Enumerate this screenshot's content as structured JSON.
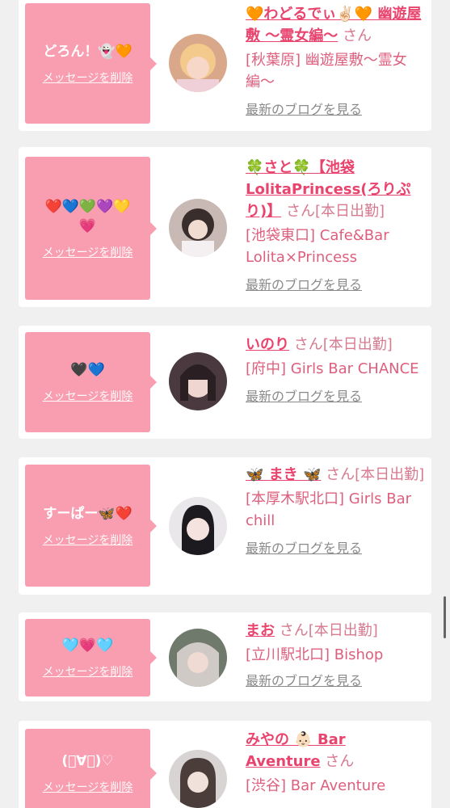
{
  "delete_label": "メッセージを削除",
  "blog_label": "最新のブログを見る",
  "san_label": "さん",
  "accent": "#f99db0",
  "cards": [
    {
      "message": "どろん！👻🧡",
      "name": "🧡わどるでぃ✌🏻🧡 幽遊屋敷 〜霊女編〜",
      "suffix": "さん",
      "shop": "[秋葉原] 幽遊屋敷〜霊女編〜"
    },
    {
      "message": "❤️💙💚💜💛💗",
      "name": "🍀さと🍀【池袋LolitaPrincess(ろりぷり)】",
      "suffix": "さん[本日出勤]",
      "shop": "[池袋東口] Cafe&Bar Lolita×Princess"
    },
    {
      "message": "🖤💙",
      "name": "いのり",
      "suffix": "さん[本日出勤]",
      "shop": "[府中] Girls Bar CHANCE"
    },
    {
      "message": "すーぱー🦋❤️",
      "name": "🦋 まき 🦋",
      "suffix": "さん[本日出勤]",
      "shop": "[本厚木駅北口] Girls Bar chill"
    },
    {
      "message": "🩵💗🩵",
      "name": "まお",
      "suffix": "さん[本日出勤]",
      "shop": "[立川駅北口] Bishop"
    },
    {
      "message": "(ﾟ∀ﾟ)♡",
      "name": "みやの 👶🏻 Bar Aventure",
      "suffix": "さん",
      "shop": "[渋谷] Bar Aventure"
    }
  ]
}
